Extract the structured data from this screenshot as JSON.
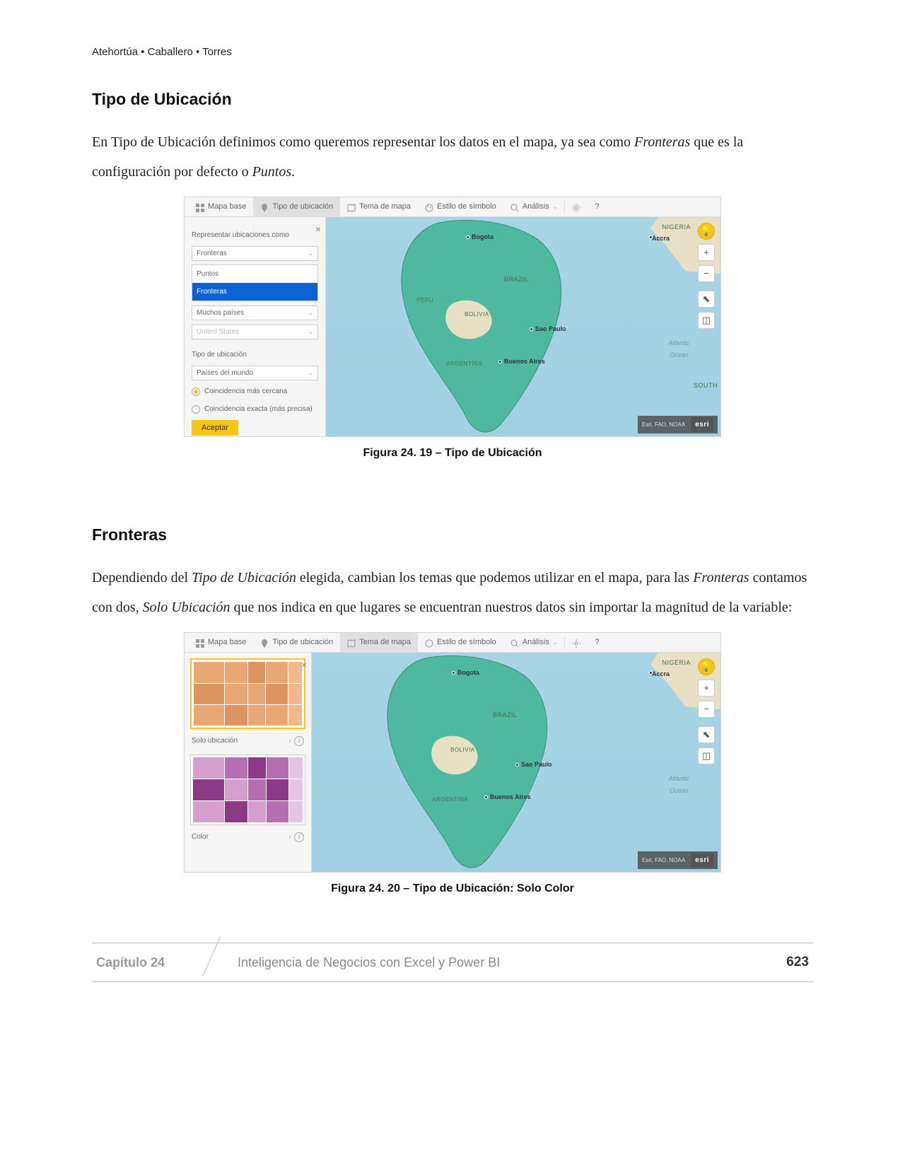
{
  "header": {
    "authors": "Atehortúa • Caballero • Torres"
  },
  "section1": {
    "heading": "Tipo de Ubicación",
    "para_before": "En Tipo de Ubicación definimos como queremos representar los datos en el mapa, ya sea como ",
    "ital1": "Fronteras",
    "para_mid": " que es la configuración por defecto o ",
    "ital2": "Puntos",
    "para_after": "."
  },
  "fig1": {
    "toolbar": {
      "base": "Mapa base",
      "loc": "Tipo de ubicación",
      "theme": "Tema de mapa",
      "symbol": "Estilo de símbolo",
      "analysis": "Análisis"
    },
    "panel": {
      "represent_label": "Representar ubicaciones como",
      "select_fronteras": "Fronteras",
      "opt_puntos": "Puntos",
      "opt_fronteras": "Fronteras",
      "select_muchos": "Muchos países",
      "select_us": "United States",
      "tipo_label": "Tipo de ubicación",
      "select_paises": "Países del mundo",
      "radio1": "Coincidencia más cercana",
      "radio2": "Coincidencia exacta (más precisa)",
      "accept": "Aceptar"
    },
    "map": {
      "nigeria": "NIGERIA",
      "accra": "Accra",
      "brazil": "BRAZIL",
      "bolivia": "BOLIVIA",
      "peru": "PERU",
      "argentina": "ARGENTINA",
      "bogota": "Bogota",
      "saopaulo": "Sao Paulo",
      "buenosaires": "Buenos Aires",
      "atlantic1": "Atlantic",
      "atlantic2": "Ocean",
      "south": "SOUTH",
      "attrib": "Esri, FAO, NOAA",
      "esri": "esri"
    },
    "caption": "Figura 24. 19 – Tipo de Ubicación"
  },
  "section2": {
    "heading": "Fronteras",
    "p_a": "Dependiendo del ",
    "p_i1": "Tipo de Ubicación",
    "p_b": " elegida, cambian los temas que podemos utilizar en el mapa, para las ",
    "p_i2": "Fronteras",
    "p_c": " contamos con dos, ",
    "p_i3": "Solo Ubicación",
    "p_d": " que nos indica en que lugares se encuentran nuestros datos sin importar la magnitud de la variable:"
  },
  "fig2": {
    "theme1": "Solo ubicación",
    "theme2": "Color",
    "caption": "Figura 24. 20 – Tipo de Ubicación: Solo Color"
  },
  "footer": {
    "chapter": "Capítulo 24",
    "title": "Inteligencia de Negocios con Excel y Power BI",
    "page": "623"
  }
}
